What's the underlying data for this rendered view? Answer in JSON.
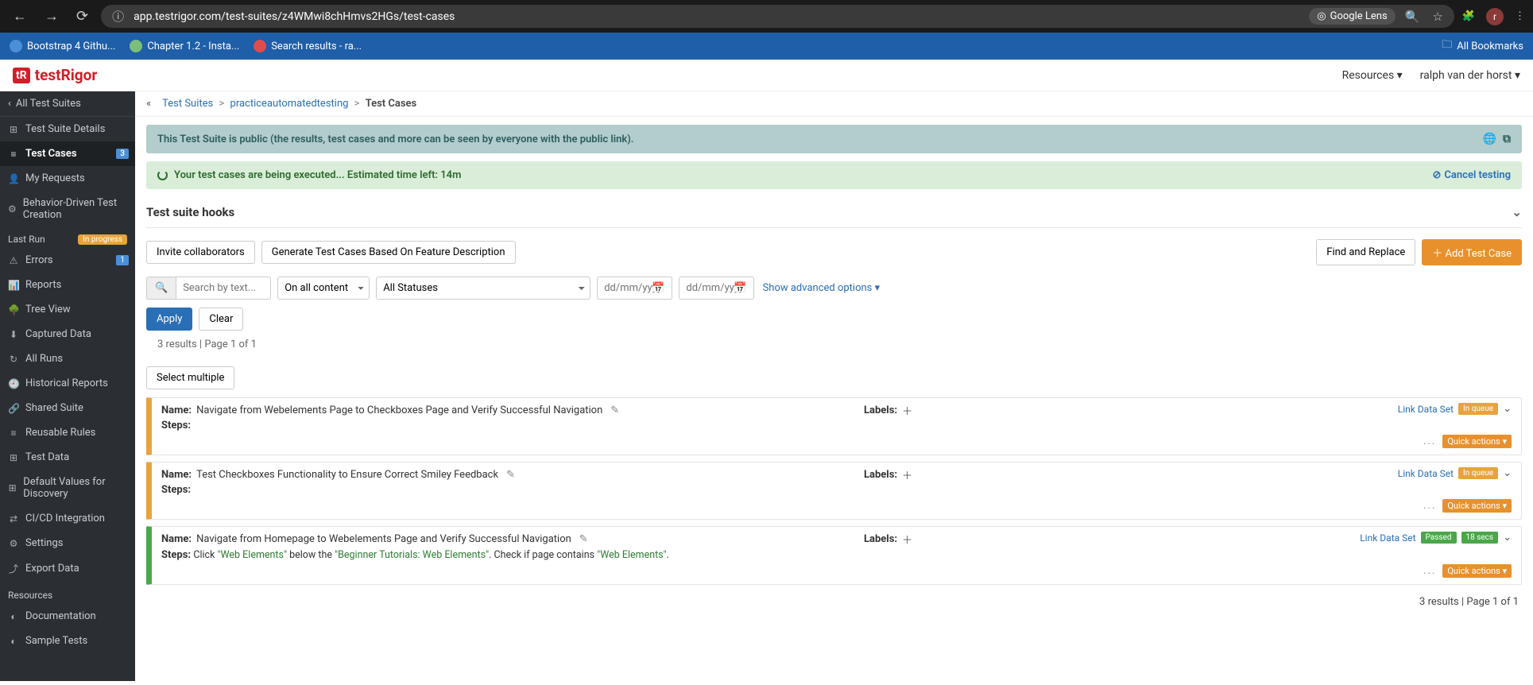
{
  "browser": {
    "url": "app.testrigor.com/test-suites/z4WMwi8chHmvs2HGs/test-cases",
    "lens": "Google Lens",
    "avatar_initial": "r",
    "bookmarks": {
      "items": [
        {
          "label": "Bootstrap 4 Githu..."
        },
        {
          "label": "Chapter 1.2 - Insta..."
        },
        {
          "label": "Search results - ra..."
        }
      ],
      "all": "All Bookmarks"
    }
  },
  "header": {
    "logo_badge": "tR",
    "logo_text": "testRigor",
    "resources": "Resources",
    "user": "ralph van der horst"
  },
  "sidebar": {
    "back": "All Test Suites",
    "items": [
      {
        "icon": "⊞",
        "label": "Test Suite Details"
      },
      {
        "icon": "≡",
        "label": "Test Cases",
        "badge": "3",
        "active": true
      },
      {
        "icon": "👤",
        "label": "My Requests"
      },
      {
        "icon": "⚙",
        "label": "Behavior-Driven Test Creation"
      }
    ],
    "last_run_head": "Last Run",
    "last_run_badge": "In progress",
    "run_items": [
      {
        "icon": "⚠",
        "label": "Errors",
        "badge": "1"
      },
      {
        "icon": "📊",
        "label": "Reports"
      },
      {
        "icon": "🌳",
        "label": "Tree View"
      },
      {
        "icon": "⬇",
        "label": "Captured Data"
      },
      {
        "icon": "↻",
        "label": "All Runs"
      },
      {
        "icon": "🕘",
        "label": "Historical Reports"
      },
      {
        "icon": "🔗",
        "label": "Shared Suite"
      },
      {
        "icon": "≡",
        "label": "Reusable Rules"
      },
      {
        "icon": "⊞",
        "label": "Test Data"
      },
      {
        "icon": "⊞",
        "label": "Default Values for Discovery"
      },
      {
        "icon": "⇄",
        "label": "CI/CD Integration"
      },
      {
        "icon": "⚙",
        "label": "Settings"
      },
      {
        "icon": "⤴",
        "label": "Export Data"
      }
    ],
    "resources_head": "Resources",
    "resource_items": [
      {
        "icon": "◐",
        "label": "Documentation"
      },
      {
        "icon": "◐",
        "label": "Sample Tests"
      }
    ]
  },
  "crumbs": {
    "a": "Test Suites",
    "b": "practiceautomatedtesting",
    "c": "Test Cases"
  },
  "alerts": {
    "public": "This Test Suite is public (the results, test cases and more can be seen by everyone with the public link).",
    "exec": "Your test cases are being executed... Estimated time left: 14m",
    "cancel": "Cancel testing"
  },
  "hooks": {
    "title": "Test suite hooks"
  },
  "toolbar": {
    "invite": "Invite collaborators",
    "generate": "Generate Test Cases Based On Feature Description",
    "find": "Find and Replace",
    "add": "Add Test Case"
  },
  "filters": {
    "search_placeholder": "Search by text...",
    "content_scope": "On all content",
    "status": "All Statuses",
    "date_ph": "dd/mm/yyyy",
    "advanced": "Show advanced options",
    "apply": "Apply",
    "clear": "Clear",
    "results_meta": "3 results | Page 1 of 1",
    "select_multiple": "Select multiple"
  },
  "labels_text": "Labels:",
  "name_text": "Name:",
  "steps_text": "Steps:",
  "link_ds": "Link Data Set",
  "quick_actions": "Quick actions ▾",
  "status_queue": "In queue",
  "status_passed": "Passed",
  "status_time": "18 secs",
  "testcases": [
    {
      "name": "Navigate from Webelements Page to Checkboxes Page and Verify Successful Navigation",
      "status": "queue"
    },
    {
      "name": "Test Checkboxes Functionality to Ensure Correct Smiley Feedback",
      "status": "queue"
    },
    {
      "name": "Navigate from Homepage to Webelements Page and Verify Successful Navigation",
      "status": "pass",
      "steps_prefix": "Click ",
      "steps_s1": "\"Web Elements\"",
      "steps_mid1": " below the ",
      "steps_s2": "\"Beginner Tutorials: Web Elements\"",
      "steps_mid2": ". Check if page contains ",
      "steps_s3": "\"Web Elements\"",
      "steps_suffix": "."
    }
  ],
  "footer_meta": "3 results | Page 1 of 1"
}
